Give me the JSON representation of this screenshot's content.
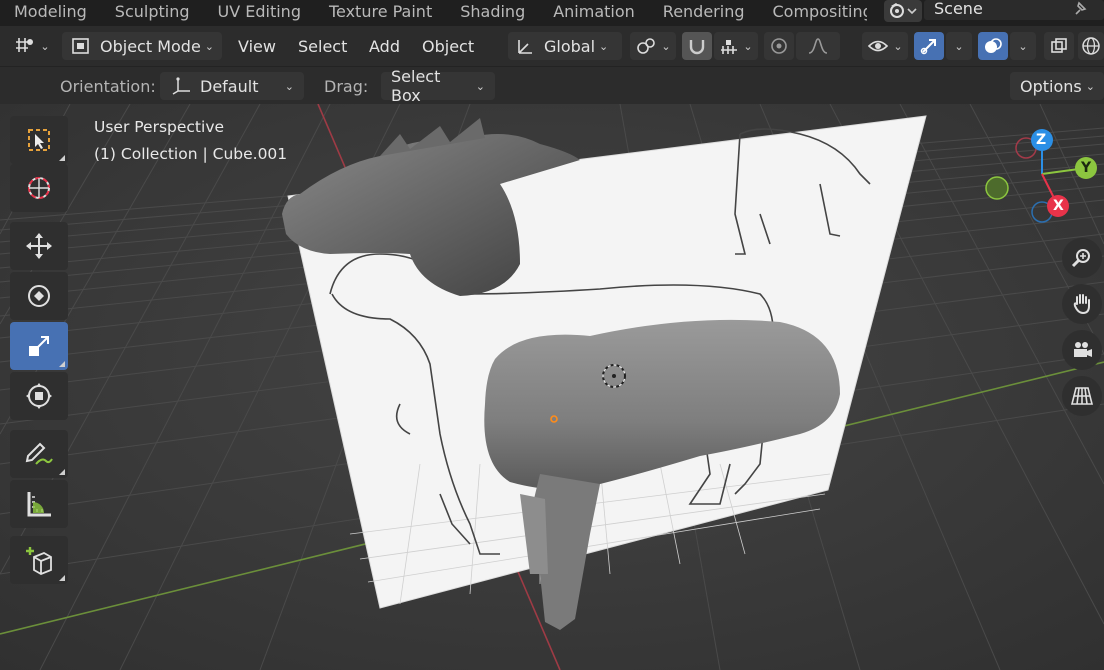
{
  "workspace_tabs": [
    "Modeling",
    "Sculpting",
    "UV Editing",
    "Texture Paint",
    "Shading",
    "Animation",
    "Rendering",
    "Compositing"
  ],
  "scene": {
    "name": "Scene"
  },
  "header": {
    "mode": "Object Mode",
    "menus": [
      "View",
      "Select",
      "Add",
      "Object"
    ],
    "transform_orientation": "Global"
  },
  "tool_settings": {
    "orientation_label": "Orientation:",
    "orientation_value": "Default",
    "drag_label": "Drag:",
    "drag_value": "Select Box",
    "options_label": "Options"
  },
  "viewport": {
    "view_name": "User Perspective",
    "collection_info": "(1) Collection | Cube.001"
  },
  "gizmo": {
    "z": "Z",
    "y": "Y",
    "x": "X"
  },
  "colors": {
    "accent": "#4771b3",
    "x_axis": "#e8334a",
    "y_axis": "#8cc63f",
    "z_axis": "#2b8fe6"
  }
}
